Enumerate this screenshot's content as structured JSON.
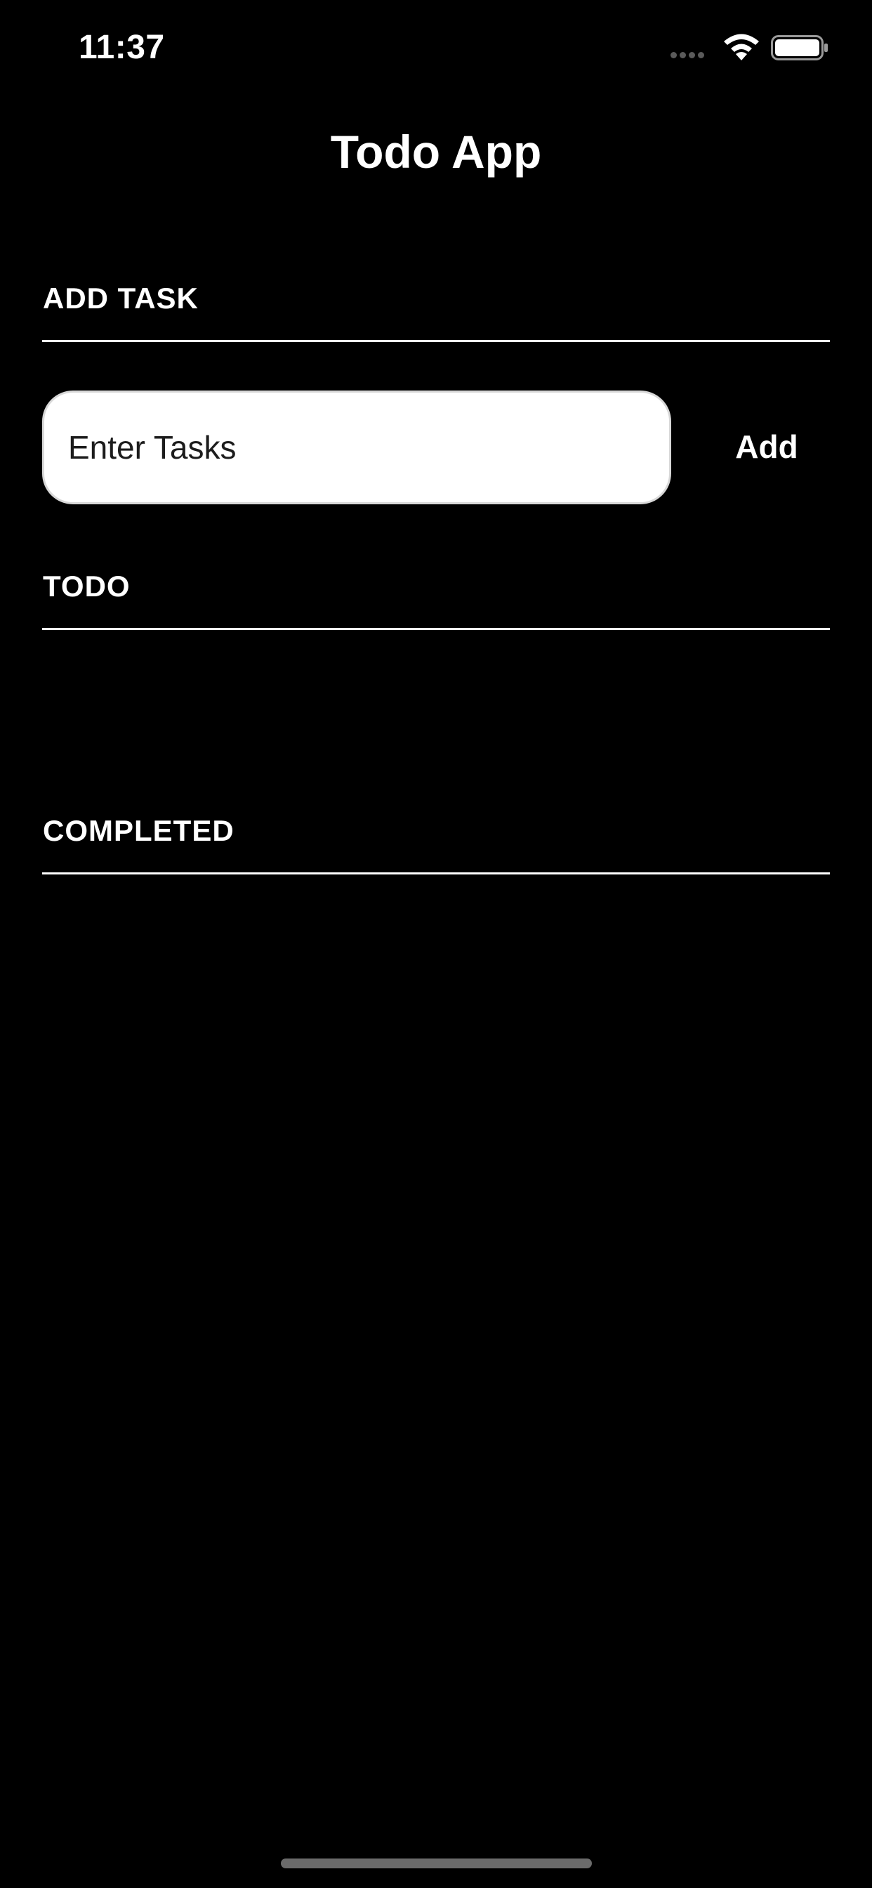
{
  "status_bar": {
    "time": "11:37"
  },
  "app": {
    "title": "Todo App"
  },
  "add_task": {
    "header": "ADD TASK",
    "input_value": "",
    "input_placeholder": "Enter Tasks",
    "add_label": "Add"
  },
  "todo": {
    "header": "TODO",
    "items": []
  },
  "completed": {
    "header": "COMPLETED",
    "items": []
  },
  "icons": {
    "wifi": "wifi-icon",
    "battery": "battery-icon",
    "signal": "signal-icon"
  },
  "colors": {
    "background": "#000000",
    "text": "#ffffff",
    "input_background": "#ffffff"
  }
}
